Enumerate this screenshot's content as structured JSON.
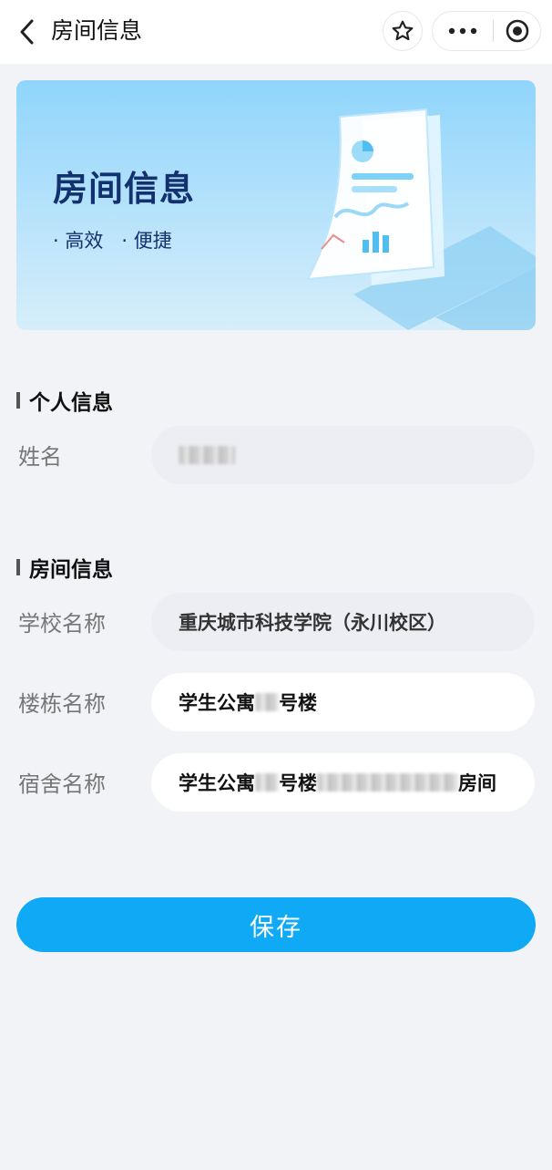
{
  "nav": {
    "title": "房间信息",
    "back_icon": "chevron-left-icon",
    "star_icon": "star-icon",
    "more_icon": "more-icon",
    "target_icon": "record-icon"
  },
  "banner": {
    "title": "房间信息",
    "tag1": "· 高效",
    "tag2": "· 便捷"
  },
  "personal": {
    "heading": "个人信息",
    "name_label": "姓名",
    "name_value": ""
  },
  "room": {
    "heading": "房间信息",
    "school_label": "学校名称",
    "school_value": "重庆城市科技学院（永川校区）",
    "building_label": "楼栋名称",
    "building_prefix": "学生公寓",
    "building_suffix": "号楼",
    "dorm_label": "宿舍名称",
    "dorm_prefix": "学生公寓",
    "dorm_mid": "号楼",
    "dorm_suffix": "房间"
  },
  "actions": {
    "save_label": "保存"
  },
  "colors": {
    "primary": "#0fa9f5",
    "banner_title": "#12316e",
    "background": "#f1f3f7"
  }
}
